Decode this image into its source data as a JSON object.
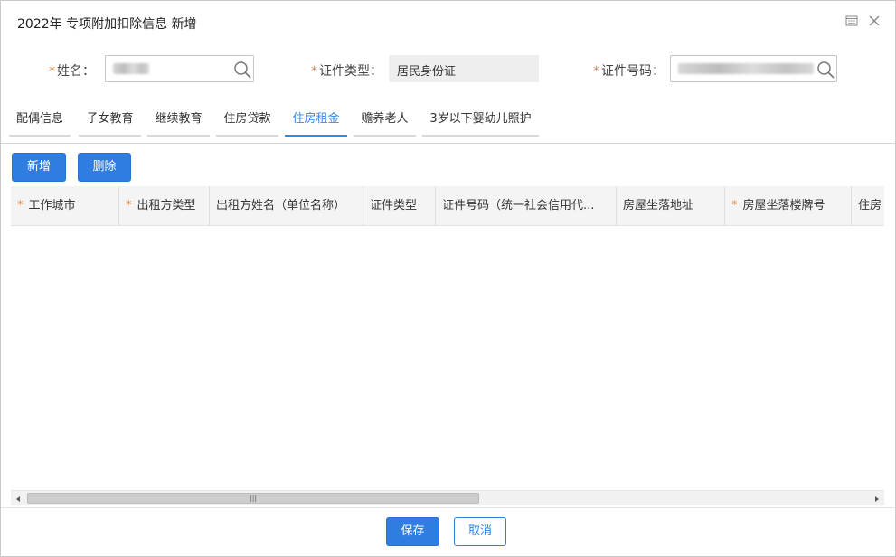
{
  "dialog": {
    "title": "2022年 专项附加扣除信息 新增",
    "maximize_icon": "maximize-icon",
    "close_icon": "close-icon"
  },
  "form": {
    "name_label": "姓名：",
    "name_value": "",
    "id_type_label": "证件类型：",
    "id_type_value": "居民身份证",
    "id_number_label": "证件号码：",
    "id_number_value": "",
    "required_mark": "*"
  },
  "tabs": [
    {
      "label": "配偶信息",
      "active": false
    },
    {
      "label": "子女教育",
      "active": false
    },
    {
      "label": "继续教育",
      "active": false
    },
    {
      "label": "住房贷款",
      "active": false
    },
    {
      "label": "住房租金",
      "active": true
    },
    {
      "label": "赡养老人",
      "active": false
    },
    {
      "label": "3岁以下婴幼儿照护",
      "active": false
    }
  ],
  "toolbar": {
    "add_label": "新增",
    "delete_label": "删除"
  },
  "grid": {
    "columns": [
      {
        "label": "工作城市",
        "required": true
      },
      {
        "label": "出租方类型",
        "required": true
      },
      {
        "label": "出租方姓名（单位名称）",
        "required": false
      },
      {
        "label": "证件类型",
        "required": false
      },
      {
        "label": "证件号码（统一社会信用代...",
        "required": false
      },
      {
        "label": "房屋坐落地址",
        "required": false
      },
      {
        "label": "房屋坐落楼牌号",
        "required": true
      },
      {
        "label": "住房",
        "required": false
      }
    ],
    "rows": [],
    "scroll_grip": "|||"
  },
  "footer": {
    "save_label": "保存",
    "cancel_label": "取消"
  },
  "colors": {
    "accent": "#2f7de1",
    "required": "#e8883a",
    "active_tab": "#3a87e0"
  }
}
